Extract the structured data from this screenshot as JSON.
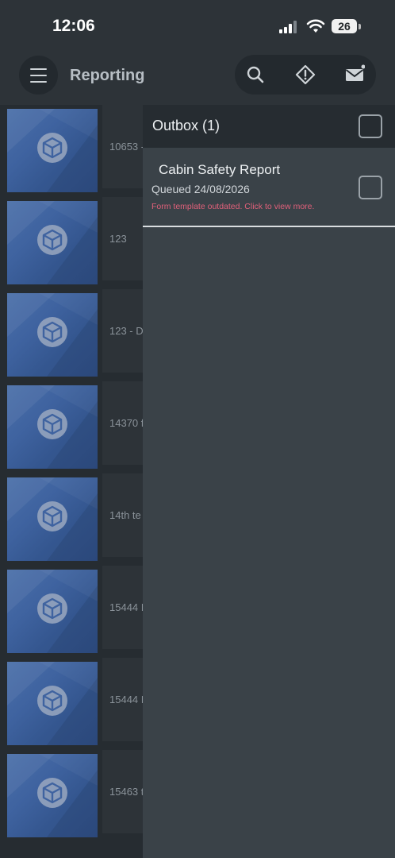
{
  "status_bar": {
    "time": "12:06",
    "battery": "26"
  },
  "header": {
    "title": "Reporting",
    "actions": [
      {
        "name": "search",
        "icon": "search-icon"
      },
      {
        "name": "hazard",
        "icon": "warning-diamond-icon"
      },
      {
        "name": "mail",
        "icon": "mail-icon"
      }
    ]
  },
  "list": {
    "items": [
      {
        "label": "10653 -"
      },
      {
        "label": "123"
      },
      {
        "label": "123 - D"
      },
      {
        "label": "14370 f"
      },
      {
        "label": "14th te"
      },
      {
        "label": "15444 I"
      },
      {
        "label": "15444 I"
      },
      {
        "label": "15463 t"
      }
    ]
  },
  "outbox": {
    "title": "Outbox (1)",
    "items": [
      {
        "title": "Cabin Safety Report",
        "status": "Queued 24/08/2026",
        "warning": "Form template outdated. Click to view more."
      }
    ]
  },
  "colors": {
    "background": "#2a3035",
    "panel": "#3a4248",
    "warning_text": "#e0607a",
    "thumbnail_blue": "#3f63a0"
  }
}
